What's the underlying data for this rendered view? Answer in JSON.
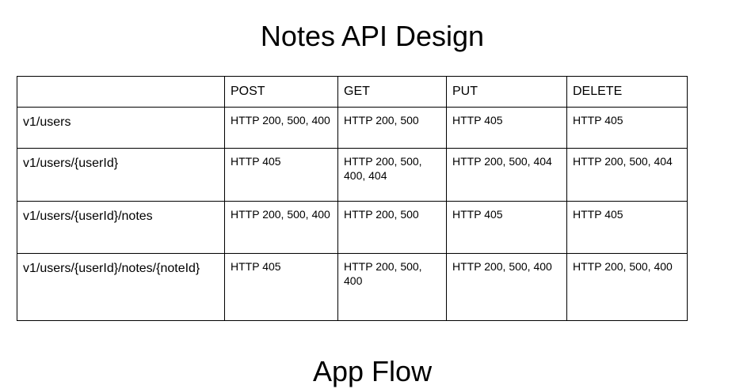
{
  "page": {
    "title": "Notes API Design",
    "next_heading": "App Flow"
  },
  "table": {
    "headers": [
      "",
      "POST",
      "GET",
      "PUT",
      "DELETE"
    ],
    "rows": [
      {
        "route": "v1/users",
        "post": "HTTP 200, 500, 400",
        "get": "HTTP 200, 500",
        "put": "HTTP 405",
        "delete": "HTTP 405"
      },
      {
        "route": "v1/users/{userId}",
        "post": "HTTP 405",
        "get": "HTTP 200, 500, 400, 404",
        "put": "HTTP 200, 500, 404",
        "delete": "HTTP 200, 500, 404"
      },
      {
        "route": "v1/users/{userId}/notes",
        "post": "HTTP 200, 500, 400",
        "get": "HTTP 200, 500",
        "put": "HTTP 405",
        "delete": "HTTP 405"
      },
      {
        "route": "v1/users/{userId}/notes/{noteId}",
        "post": "HTTP 405",
        "get": "HTTP 200, 500, 400",
        "put": "HTTP 200, 500, 400",
        "delete": "HTTP 200, 500, 400"
      }
    ]
  }
}
